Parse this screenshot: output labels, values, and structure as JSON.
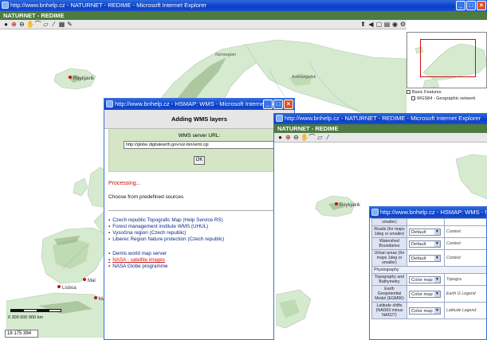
{
  "main_window": {
    "title": "http://www.bnhelp.cz - NATURNET - REDIME - Microsoft Internet Explorer",
    "app_title": "NATURNET - REDIME",
    "status_coords": "18 175 394",
    "scale_labels": "0    300   600  900 km",
    "cities": [
      {
        "name": "Reykjavík"
      },
      {
        "name": "Lisboa"
      },
      {
        "name": "Mal"
      },
      {
        "name": "Ma"
      }
    ],
    "region_labels": [
      "Norwegian",
      "Arkhangelsk"
    ]
  },
  "legend": {
    "items": [
      "Basic Features",
      "WGS84 - Geographic network"
    ]
  },
  "wms_dialog": {
    "title": "http://www.bnhelp.cz - HSMAP: WMS - Microsoft Internet Expl...",
    "heading": "Adding WMS layers",
    "server_label": "WMS server URL:",
    "server_url": "http://globe.digitalearth.gov/viz-bin/wmt.cgi",
    "ok_label": "OK",
    "processing": "Processing...",
    "choose": "Choose from predefined sources",
    "sources": [
      "Czech republic Topografic Map (Help Service RS)",
      "Forest management institute WMS (UHUL)",
      "Vysočina region (Czech republic)",
      "Liberec Region Nature protection (Czech republic)"
    ],
    "sources2": [
      "Demis world map server",
      "NASA - satellite images",
      "NASA Globe programme"
    ]
  },
  "second_window": {
    "title": "http://www.bnhelp.cz - NATURNET - REDIME - Microsoft Internet Explorer",
    "app_title": "NATURNET - REDIME",
    "city": "Reykjavík"
  },
  "layers_dialog": {
    "title": "http://www.bnhelp.cz - HSMAP: WMS - Microsoft ...",
    "rows": [
      {
        "name": "smaller)",
        "select": "",
        "desc": ""
      },
      {
        "name": "Roads (for maps 1deg or smaller)",
        "select": "Default",
        "desc": "Context"
      },
      {
        "name": "Watershed Boundaries",
        "select": "Default",
        "desc": "Context"
      },
      {
        "name": "Urban areas (for maps 1deg or smaller)",
        "select": "Default",
        "desc": "Context"
      },
      {
        "name": "Physiography",
        "select": "",
        "desc": ""
      },
      {
        "name": "Topography and Bathymetry",
        "select": "Color map",
        "desc": "Topogra"
      },
      {
        "name": "Earth Geopotential Model (EGM96)",
        "select": "Color map",
        "desc": "Earth G Legend"
      },
      {
        "name": "Latitude shifts (NAD83 minus NAD27)",
        "select": "Color map",
        "desc": "Latitude Legend"
      }
    ]
  }
}
